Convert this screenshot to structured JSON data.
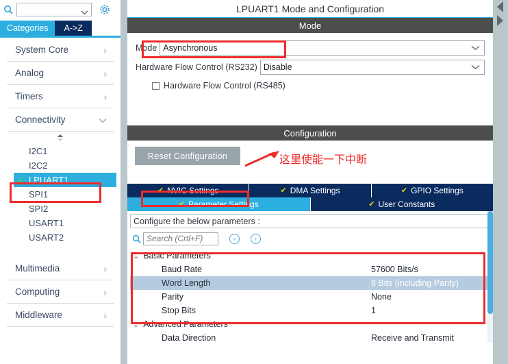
{
  "left_panel": {
    "search": {
      "value": "",
      "placeholder": ""
    },
    "gear_icon": "gear-icon",
    "search_icon": "search-icon",
    "tabs": [
      {
        "label": "Categories",
        "active": true
      },
      {
        "label": "A->Z",
        "active": false
      }
    ],
    "categories": [
      {
        "label": "System Core",
        "expanded": false,
        "chevron": "›"
      },
      {
        "label": "Analog",
        "expanded": false,
        "chevron": "›"
      },
      {
        "label": "Timers",
        "expanded": false,
        "chevron": "›"
      },
      {
        "label": "Connectivity",
        "expanded": true,
        "chevron": "⌄"
      }
    ],
    "connectivity_items": [
      {
        "label": "I2C1",
        "selected": false
      },
      {
        "label": "I2C2",
        "selected": false
      },
      {
        "label": "LPUART1",
        "selected": true
      },
      {
        "label": "SPI1",
        "selected": false
      },
      {
        "label": "SPI2",
        "selected": false
      },
      {
        "label": "USART1",
        "selected": false
      },
      {
        "label": "USART2",
        "selected": false
      }
    ],
    "categories_tail": [
      {
        "label": "Multimedia",
        "chevron": "›"
      },
      {
        "label": "Computing",
        "chevron": "›"
      },
      {
        "label": "Middleware",
        "chevron": "›"
      }
    ]
  },
  "right_panel": {
    "title": "LPUART1 Mode and Configuration",
    "mode_section": {
      "header": "Mode",
      "mode_label": "Mode",
      "mode_value": "Asynchronous",
      "flow_label": "Hardware Flow Control (RS232)",
      "flow_value": "Disable",
      "rs485_label": "Hardware Flow Control (RS485)",
      "rs485_checked": false
    },
    "configuration_section": {
      "header": "Configuration",
      "reset_button": "Reset Configuration",
      "annotation": "这里使能一下中断",
      "tabs_row1": [
        {
          "label": "NVIC Settings",
          "active": false
        },
        {
          "label": "DMA Settings",
          "active": false
        },
        {
          "label": "GPIO Settings",
          "active": false
        }
      ],
      "tabs_row2": [
        {
          "label": "Parameter Settings",
          "active": true
        },
        {
          "label": "User Constants",
          "active": false
        }
      ],
      "configure_hint": "Configure the below parameters :",
      "search_placeholder": "Search (Crtl+F)",
      "search_value": "",
      "nav_prev": "‹",
      "nav_next": "›",
      "groups": [
        {
          "name": "Basic Parameters",
          "expanded": true,
          "rows": [
            {
              "key": "Baud Rate",
              "value": "57600 Bits/s",
              "highlighted": false
            },
            {
              "key": "Word Length",
              "value": "8 Bits (including Parity)",
              "highlighted": true
            },
            {
              "key": "Parity",
              "value": "None",
              "highlighted": false
            },
            {
              "key": "Stop Bits",
              "value": "1",
              "highlighted": false
            }
          ]
        },
        {
          "name": "Advanced Parameters",
          "expanded": true,
          "rows": [
            {
              "key": "Data Direction",
              "value": "Receive and Transmit",
              "highlighted": false
            }
          ]
        }
      ]
    }
  },
  "colors": {
    "accent_blue": "#2daee0",
    "dark_navy": "#0a2b5e",
    "highlight_red": "#ee2b2b",
    "section_gray": "#4d4d4d",
    "row_highlight": "#b5cbdf",
    "check_green": "#5cd13f",
    "tick_yellow": "#f2d600"
  }
}
